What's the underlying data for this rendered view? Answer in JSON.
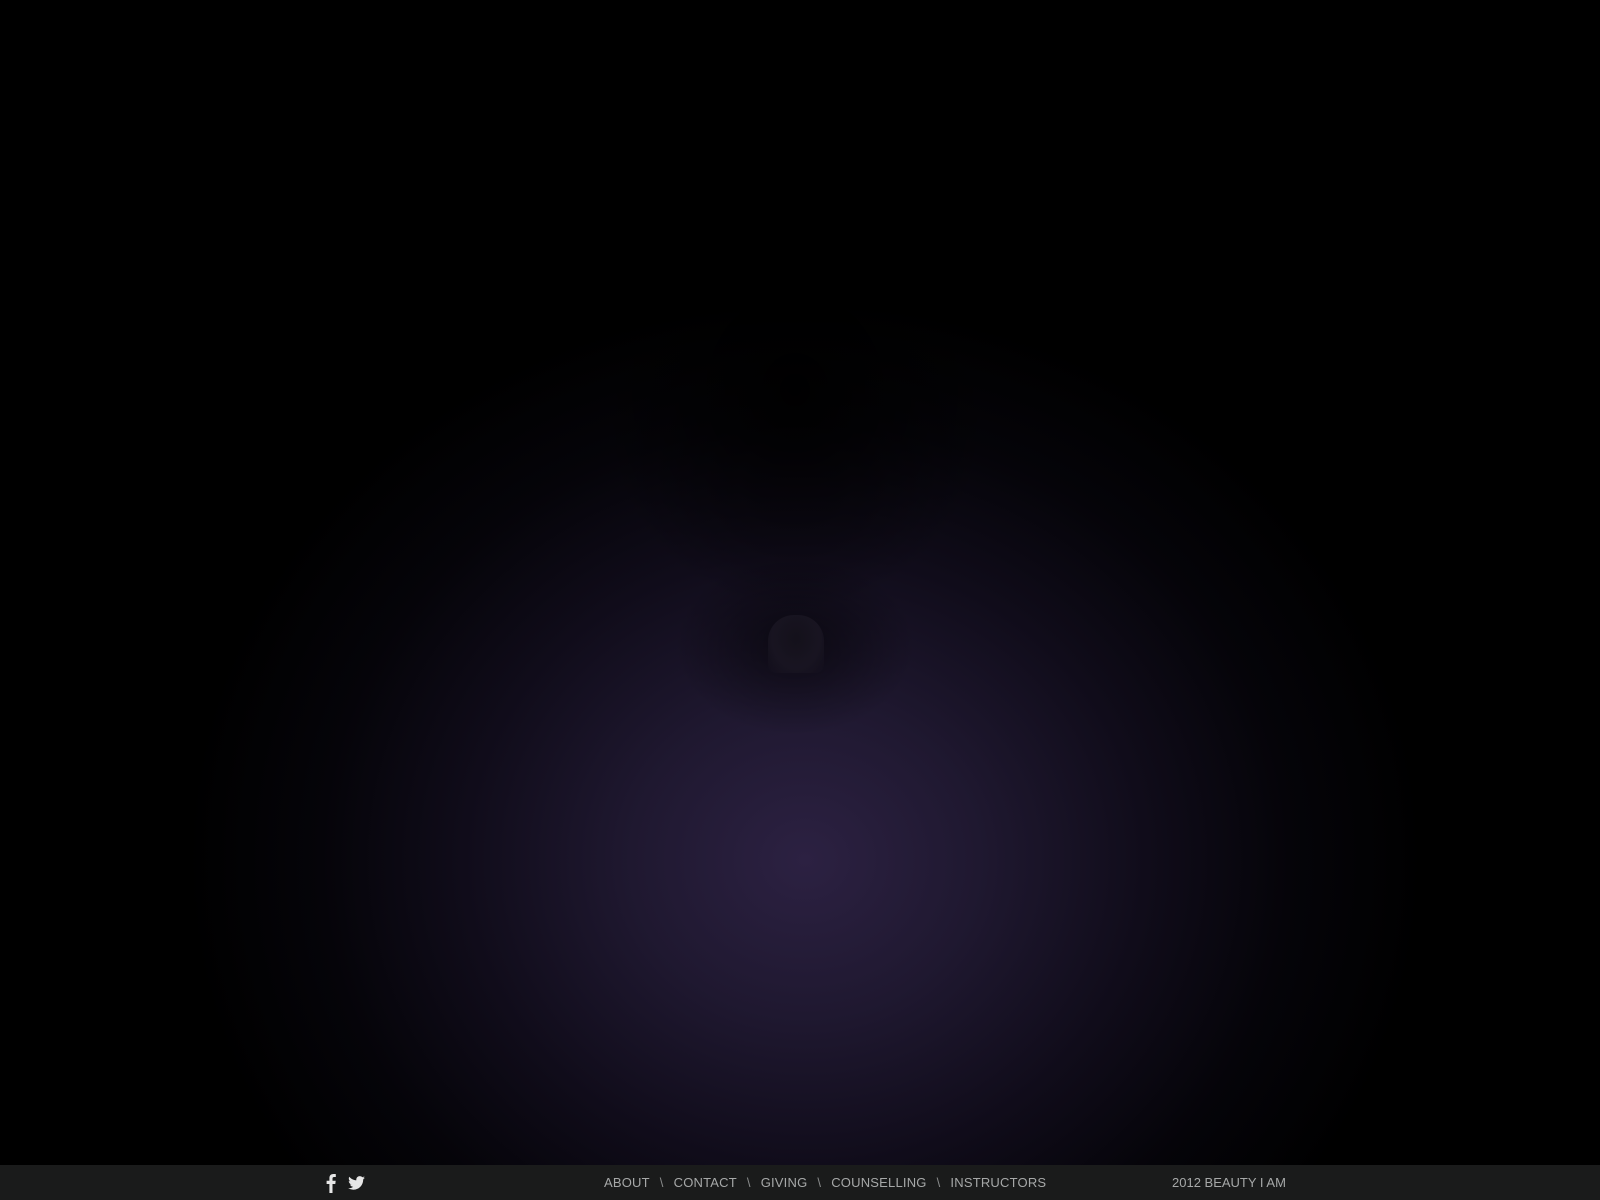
{
  "footer": {
    "social": [
      {
        "icon": "facebook-icon"
      },
      {
        "icon": "twitter-icon"
      }
    ],
    "nav": [
      {
        "label": "ABOUT"
      },
      {
        "label": "CONTACT"
      },
      {
        "label": "GIVING"
      },
      {
        "label": "COUNSELLING"
      },
      {
        "label": "INSTRUCTORS"
      }
    ],
    "separator": "\\",
    "copyright": "2012 BEAUTY I AM"
  },
  "colors": {
    "background": "#000000",
    "glow": "#2c2142",
    "footer_bg": "#1a1b1b",
    "footer_text": "#a6a8a8"
  }
}
